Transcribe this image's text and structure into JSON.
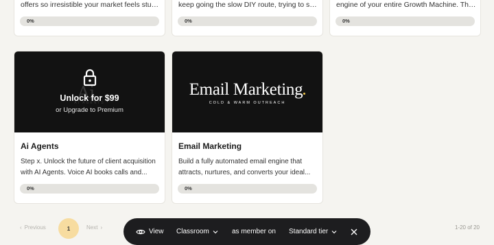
{
  "top_row": [
    {
      "description": "offers so irresistible your market feels stupi...",
      "progress_label": "0%",
      "progress": 0
    },
    {
      "description": "keep going the slow DIY route, trying to stitc...",
      "progress_label": "0%",
      "progress": 0
    },
    {
      "description": "engine of your entire Growth Machine. This ...",
      "progress_label": "0%",
      "progress": 0
    }
  ],
  "courses": [
    {
      "locked": true,
      "faint_logo": "Ai",
      "faint_logo_sub": "AI AGENTS",
      "unlock_title": "Unlock for $99",
      "unlock_sub": "or Upgrade to Premium",
      "lock_icon": "lock-icon",
      "title": "Ai Agents",
      "description": "Step x. Unlock the future of client acquisition with AI Agents. Voice AI books calls and...",
      "progress_label": "0%",
      "progress": 0
    },
    {
      "locked": false,
      "logo_text": "Email Marketing",
      "logo_sub": "COLD & WARM OUTREACH",
      "title": "Email Marketing",
      "description": "Build a fully automated email engine that attracts, nurtures, and converts your ideal...",
      "progress_label": "0%",
      "progress": 0
    }
  ],
  "pagination": {
    "prev_label": "Previous",
    "next_label": "Next",
    "current_page": "1",
    "count_text": "1-20 of 20"
  },
  "toolbar": {
    "view_label": "View",
    "view_icon": "eye-icon",
    "classroom_label": "Classroom",
    "member_label": "as member on",
    "tier_label": "Standard tier",
    "close_icon": "close-icon"
  },
  "colors": {
    "background": "#f5f4f0",
    "accent": "#f2c94c",
    "toolbar_bg": "#1d1d1f"
  }
}
